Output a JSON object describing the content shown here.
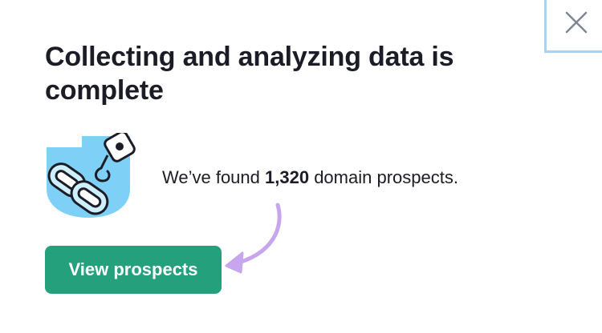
{
  "dialog": {
    "title": "Collecting and analyzing data is complete",
    "message": {
      "prefix": "We’ve found ",
      "count": "1,320",
      "suffix": " domain prospects."
    },
    "primary_button_label": "View prospects",
    "close_icon": "close-icon",
    "illustration_icon": "chain-link-illustration",
    "arrow_icon": "curved-arrow-icon"
  },
  "colors": {
    "button_bg": "#25a07c",
    "button_text": "#ffffff",
    "title": "#1c1c26",
    "accent_blue": "#7fd0f7",
    "arrow_purple": "#c8a6ee",
    "close_frame": "#a9d3f5"
  }
}
